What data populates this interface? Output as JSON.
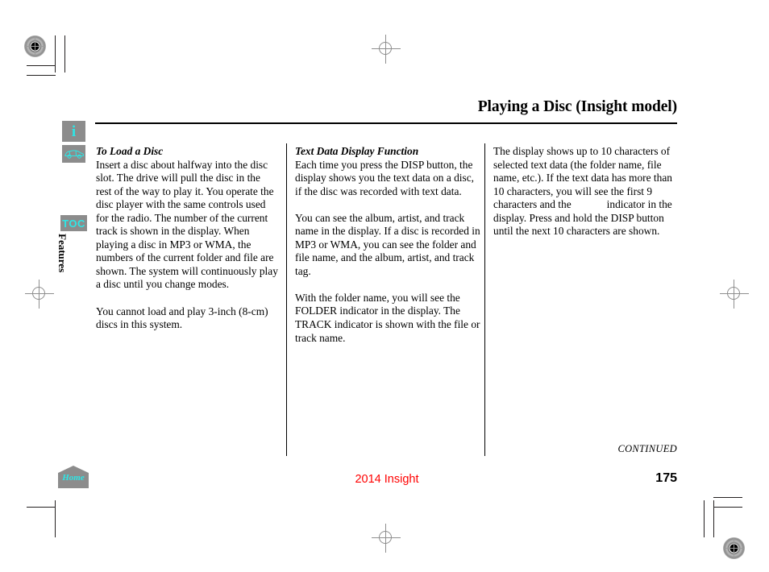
{
  "header": {
    "title": "Playing a Disc (Insight model)"
  },
  "sidebar": {
    "info_icon_label": "i",
    "car_icon_name": "vehicle-icon",
    "toc_label": "TOC",
    "section_label": "Features",
    "home_label": "Home"
  },
  "columns": {
    "col1": {
      "subhead": "To Load a Disc",
      "paragraphs": [
        "Insert a disc about halfway into the disc slot. The drive will pull the disc in the rest of the way to play it. You operate the disc player with the same controls used for the radio. The number of the current track is shown in the display. When playing a disc in MP3 or WMA, the numbers of the current folder and file are shown. The system will continuously play a disc until you change modes.",
        "You cannot load and play 3-inch (8-cm) discs in this system."
      ]
    },
    "col2": {
      "subhead": "Text Data Display Function",
      "paragraphs": [
        "Each time you press the DISP button, the display shows you the text data on a disc, if the disc was recorded with text data.",
        "You can see the album, artist, and track name in the display. If a disc is recorded in MP3 or WMA, you can see the folder and file name, and the album, artist, and track tag.",
        "With the folder name, you will see the FOLDER indicator in the display. The TRACK indicator is shown with the file or track name."
      ]
    },
    "col3": {
      "paragraph_part1": "The display shows up to 10 characters of selected text data (the folder name, file name, etc.). If the text data has more than 10 characters, you will see the first 9 characters and the",
      "paragraph_part2": "indicator in the display. Press and hold the DISP button until the next 10 characters are shown."
    }
  },
  "footer": {
    "continued": "CONTINUED",
    "model_year": "2014 Insight",
    "page_number": "175"
  }
}
